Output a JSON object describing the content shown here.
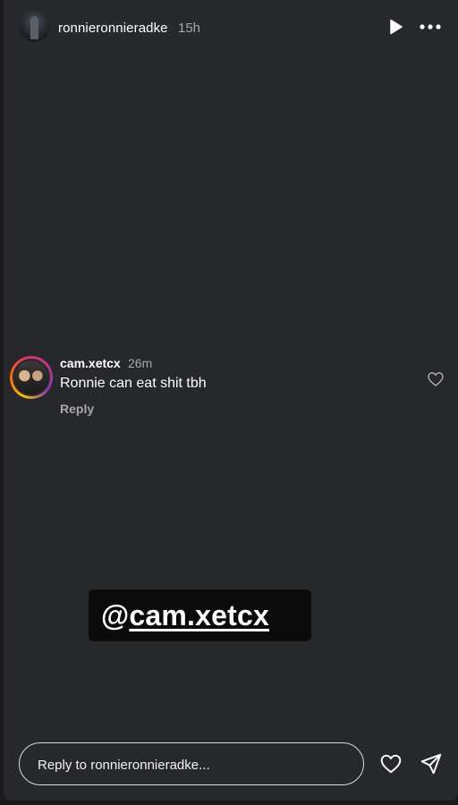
{
  "header": {
    "username": "ronnieronnieradke",
    "time": "15h",
    "play_icon": "play-icon",
    "more_icon": "more-horizontal-icon"
  },
  "comment": {
    "username": "cam.xetcx",
    "time": "26m",
    "text": "Ronnie can eat shit tbh",
    "reply_label": "Reply",
    "like_icon": "heart-outline-icon"
  },
  "mention": {
    "prefix": "@",
    "handle": "cam.xetcx"
  },
  "footer": {
    "reply_placeholder": "Reply to ronnieronnieradke...",
    "like_icon": "heart-outline-icon",
    "send_icon": "send-icon"
  },
  "colors": {
    "background": "#26282b",
    "muted_text": "#a8a8a8",
    "sticker_bg": "#0b0b0c"
  }
}
